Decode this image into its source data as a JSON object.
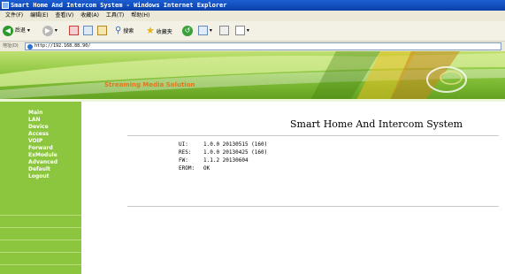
{
  "window": {
    "title": "Smart Home And Intercom System - Windows Internet Explorer"
  },
  "menubar": {
    "items": [
      "文件(F)",
      "编辑(E)",
      "查看(V)",
      "收藏(A)",
      "工具(T)",
      "帮助(H)"
    ]
  },
  "toolbar": {
    "back_label": "后退",
    "search_label": "搜索",
    "favorites_label": "收藏夹"
  },
  "address": {
    "label": "地址(D)",
    "url": "http://192.168.88.90/"
  },
  "banner": {
    "slogan": "Streaming Media Solution"
  },
  "sidebar": {
    "items": [
      {
        "label": "Main"
      },
      {
        "label": "LAN"
      },
      {
        "label": "Device"
      },
      {
        "label": "Access"
      },
      {
        "label": "VOIP"
      },
      {
        "label": "Forward"
      },
      {
        "label": "ExModule"
      },
      {
        "label": "Advanced"
      },
      {
        "label": "Default"
      },
      {
        "label": "Logout"
      }
    ]
  },
  "main": {
    "title": "Smart Home And Intercom System",
    "info": [
      {
        "key": "UI:",
        "value": "1.0.0 20130515 (160)"
      },
      {
        "key": "RES:",
        "value": "1.0.0 20130425 (160)"
      },
      {
        "key": "FW:",
        "value": "1.1.2 20130604"
      },
      {
        "key": "EROM:",
        "value": "OK"
      }
    ]
  },
  "colors": {
    "accent_green": "#8cc63f",
    "slogan_orange": "#e8751a",
    "titlebar_blue": "#0a3fa8"
  }
}
